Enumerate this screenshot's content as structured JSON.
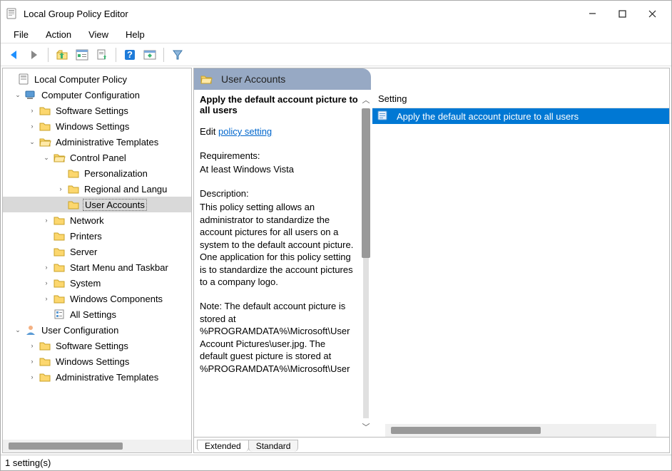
{
  "titlebar": {
    "title": "Local Group Policy Editor"
  },
  "menubar": {
    "items": [
      "File",
      "Action",
      "View",
      "Help"
    ]
  },
  "tree": {
    "root": "Local Computer Policy",
    "computer_config": "Computer Configuration",
    "cc_software": "Software Settings",
    "cc_windows": "Windows Settings",
    "cc_admin": "Administrative Templates",
    "cc_control": "Control Panel",
    "cc_personalization": "Personalization",
    "cc_regional": "Regional and Langu",
    "cc_useraccounts": "User Accounts",
    "cc_network": "Network",
    "cc_printers": "Printers",
    "cc_server": "Server",
    "cc_startmenu": "Start Menu and Taskbar",
    "cc_system": "System",
    "cc_wincomp": "Windows Components",
    "cc_allsettings": "All Settings",
    "user_config": "User Configuration",
    "uc_software": "Software Settings",
    "uc_windows": "Windows Settings",
    "uc_admin": "Administrative Templates"
  },
  "rightpane": {
    "header": "User Accounts",
    "desc_title": "Apply the default account picture to all users",
    "edit_label": "Edit ",
    "edit_link": "policy setting",
    "req_label": "Requirements:",
    "req_value": "At least Windows Vista",
    "desc_label": "Description:",
    "desc_body": "This policy setting allows an administrator to standardize the account pictures for all users on a system to the default account picture. One application for this policy setting is to standardize the account pictures to a company logo.",
    "note_body": "Note: The default account picture is stored at %PROGRAMDATA%\\Microsoft\\User Account Pictures\\user.jpg. The default guest picture is stored at %PROGRAMDATA%\\Microsoft\\User",
    "list_header": "Setting",
    "list_item": "Apply the default account picture to all users",
    "tabs": {
      "extended": "Extended",
      "standard": "Standard"
    }
  },
  "statusbar": {
    "text": "1 setting(s)"
  }
}
